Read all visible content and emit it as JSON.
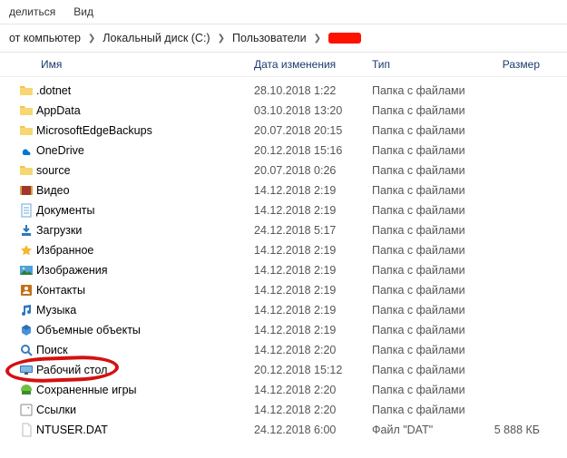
{
  "menu": {
    "share": "делиться",
    "view": "Вид"
  },
  "breadcrumb": {
    "crumb0": "от компьютер",
    "crumb1": "Локальный диск (C:)",
    "crumb2": "Пользователи"
  },
  "columns": {
    "name": "Имя",
    "date": "Дата изменения",
    "type": "Тип",
    "size": "Размер"
  },
  "items": [
    {
      "icon": "folder",
      "name": ".dotnet",
      "date": "28.10.2018 1:22",
      "type": "Папка с файлами",
      "size": ""
    },
    {
      "icon": "folder",
      "name": "AppData",
      "date": "03.10.2018 13:20",
      "type": "Папка с файлами",
      "size": ""
    },
    {
      "icon": "folder",
      "name": "MicrosoftEdgeBackups",
      "date": "20.07.2018 20:15",
      "type": "Папка с файлами",
      "size": ""
    },
    {
      "icon": "onedrive",
      "name": "OneDrive",
      "date": "20.12.2018 15:16",
      "type": "Папка с файлами",
      "size": ""
    },
    {
      "icon": "folder",
      "name": "source",
      "date": "20.07.2018 0:26",
      "type": "Папка с файлами",
      "size": ""
    },
    {
      "icon": "video",
      "name": "Видео",
      "date": "14.12.2018 2:19",
      "type": "Папка с файлами",
      "size": ""
    },
    {
      "icon": "document",
      "name": "Документы",
      "date": "14.12.2018 2:19",
      "type": "Папка с файлами",
      "size": ""
    },
    {
      "icon": "download",
      "name": "Загрузки",
      "date": "24.12.2018 5:17",
      "type": "Папка с файлами",
      "size": ""
    },
    {
      "icon": "star",
      "name": "Избранное",
      "date": "14.12.2018 2:19",
      "type": "Папка с файлами",
      "size": ""
    },
    {
      "icon": "picture",
      "name": "Изображения",
      "date": "14.12.2018 2:19",
      "type": "Папка с файлами",
      "size": ""
    },
    {
      "icon": "contacts",
      "name": "Контакты",
      "date": "14.12.2018 2:19",
      "type": "Папка с файлами",
      "size": ""
    },
    {
      "icon": "music",
      "name": "Музыка",
      "date": "14.12.2018 2:19",
      "type": "Папка с файлами",
      "size": ""
    },
    {
      "icon": "objects",
      "name": "Объемные объекты",
      "date": "14.12.2018 2:19",
      "type": "Папка с файлами",
      "size": ""
    },
    {
      "icon": "search",
      "name": "Поиск",
      "date": "14.12.2018 2:20",
      "type": "Папка с файлами",
      "size": ""
    },
    {
      "icon": "desktop",
      "name": "Рабочий стол",
      "date": "20.12.2018 15:12",
      "type": "Папка с файлами",
      "size": "",
      "highlight": true
    },
    {
      "icon": "saved",
      "name": "Сохраненные игры",
      "date": "14.12.2018 2:20",
      "type": "Папка с файлами",
      "size": ""
    },
    {
      "icon": "links",
      "name": "Ссылки",
      "date": "14.12.2018 2:20",
      "type": "Папка с файлами",
      "size": ""
    },
    {
      "icon": "file",
      "name": "NTUSER.DAT",
      "date": "24.12.2018 6:00",
      "type": "Файл \"DAT\"",
      "size": "5 888 КБ"
    }
  ]
}
